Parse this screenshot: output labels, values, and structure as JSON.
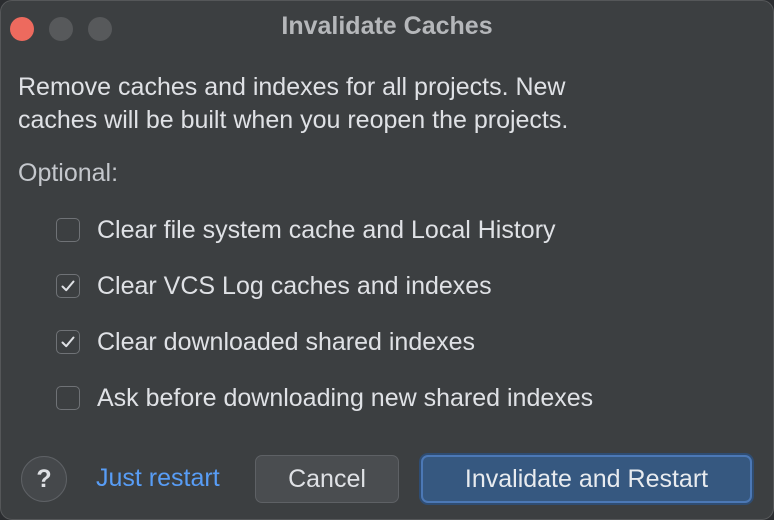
{
  "window": {
    "title": "Invalidate Caches"
  },
  "dialog": {
    "description": "Remove caches and indexes for all projects. New\ncaches will be built when you reopen the projects.",
    "optional_label": "Optional:",
    "options": [
      {
        "label": "Clear file system cache and Local History",
        "checked": false
      },
      {
        "label": "Clear VCS Log caches and indexes",
        "checked": true
      },
      {
        "label": "Clear downloaded shared indexes",
        "checked": true
      },
      {
        "label": "Ask before downloading new shared indexes",
        "checked": false
      }
    ]
  },
  "footer": {
    "help_label": "?",
    "just_restart_label": "Just restart",
    "cancel_label": "Cancel",
    "primary_label": "Invalidate and Restart"
  },
  "colors": {
    "background": "#3c3f41",
    "accent": "#365880",
    "link": "#589df6",
    "close": "#ed6a5e"
  }
}
